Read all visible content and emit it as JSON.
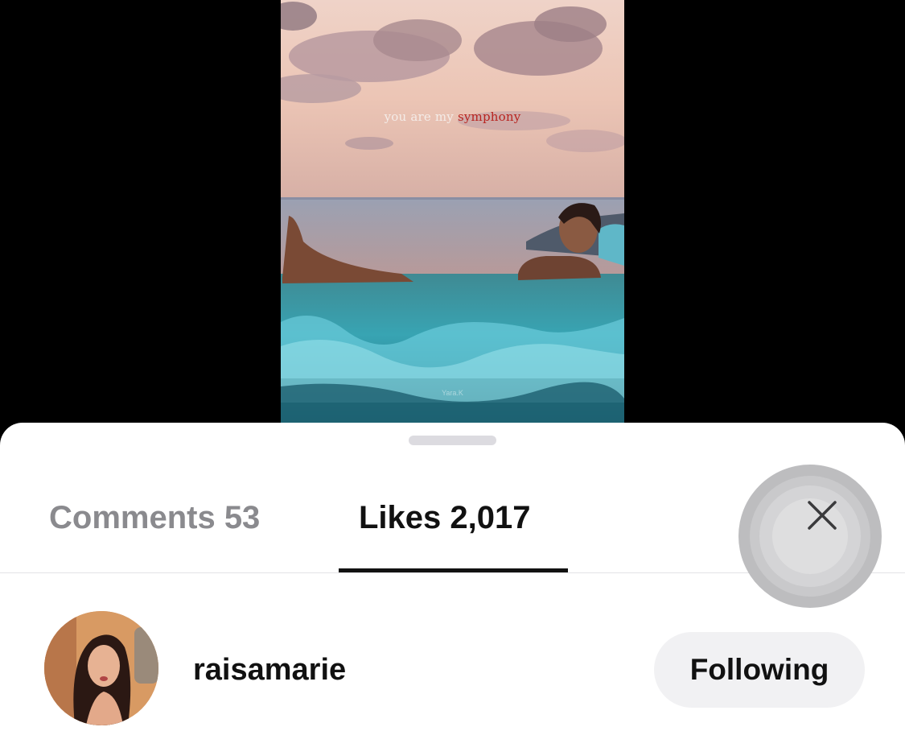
{
  "video": {
    "caption_prefix": "you are my",
    "caption_accent": "symphony",
    "watermark": "Yara.K",
    "accent_color": "#b8231f"
  },
  "sheet": {
    "tabs": [
      {
        "label": "Comments 53",
        "active": false
      },
      {
        "label": "Likes 2,017",
        "active": true
      }
    ],
    "close_icon": "close-icon",
    "likes": [
      {
        "username": "raisamarie",
        "button_label": "Following"
      }
    ]
  }
}
